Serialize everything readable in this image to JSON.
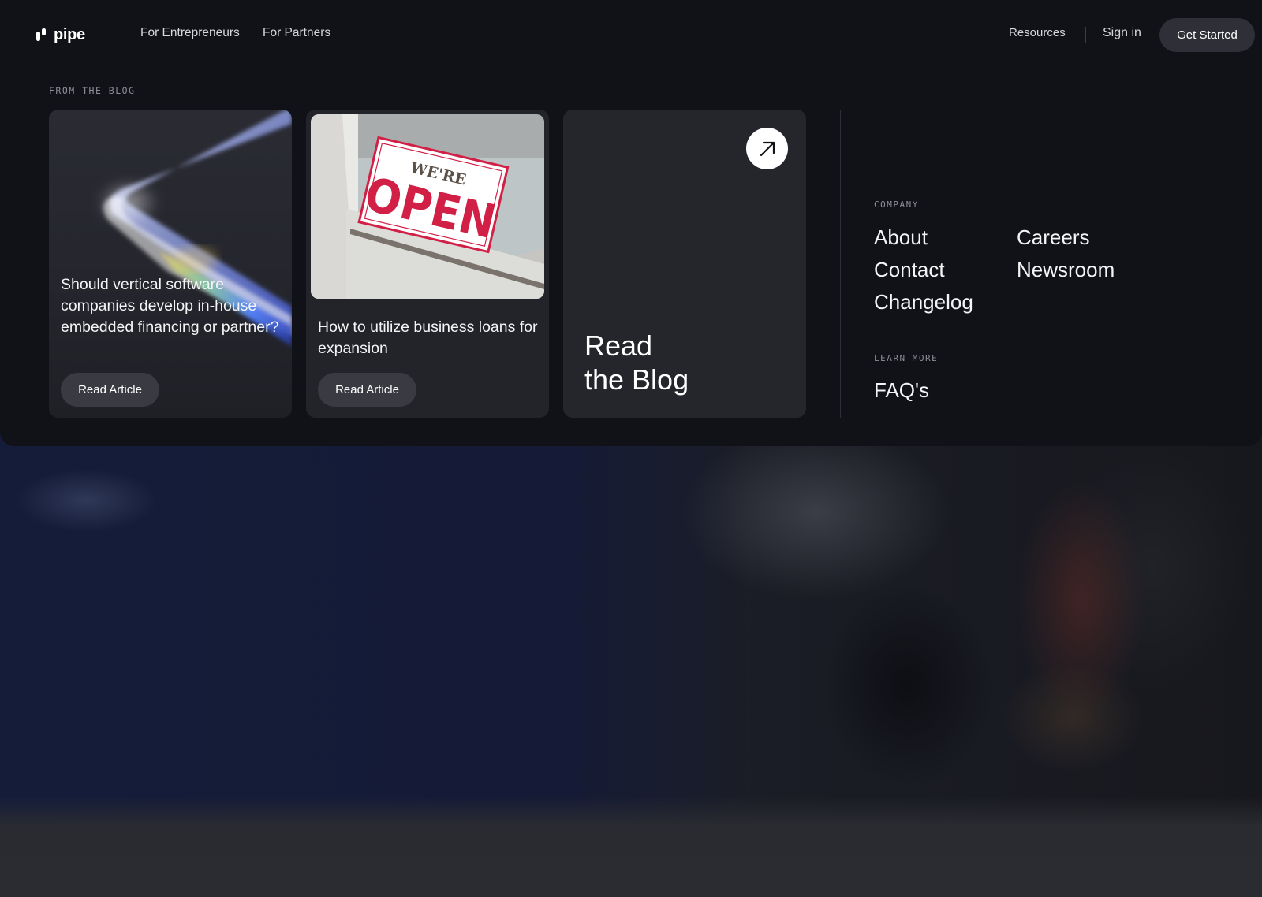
{
  "brand": {
    "name": "pipe",
    "logo_icon": "pipe-logo-icon"
  },
  "nav": {
    "left_links": [
      "For Entrepreneurs",
      "For Partners"
    ],
    "resources": "Resources",
    "sign_in": "Sign in",
    "get_started": "Get Started"
  },
  "blog": {
    "eyebrow": "FROM THE BLOG",
    "articles": [
      {
        "title": "Should vertical software companies develop in-house embedded financing or partner?",
        "button": "Read Article"
      },
      {
        "title": "How to utilize business loans for expansion",
        "button": "Read Article",
        "image_sign_top": "WE'RE",
        "image_sign_main": "OPEN"
      }
    ],
    "read_blog": {
      "line1": "Read",
      "line2": "the Blog",
      "icon": "arrow-up-right-icon"
    }
  },
  "company": {
    "eyebrow": "COMPANY",
    "links": [
      "About",
      "Careers",
      "Contact",
      "Newsroom",
      "Changelog"
    ]
  },
  "learn_more": {
    "eyebrow": "LEARN MORE",
    "links": [
      "FAQ's"
    ]
  },
  "colors": {
    "panel": "#111217",
    "card": "#23242a",
    "button": "#3a3b42",
    "cta": "#2f3037",
    "sign_red": "#d11f45"
  }
}
